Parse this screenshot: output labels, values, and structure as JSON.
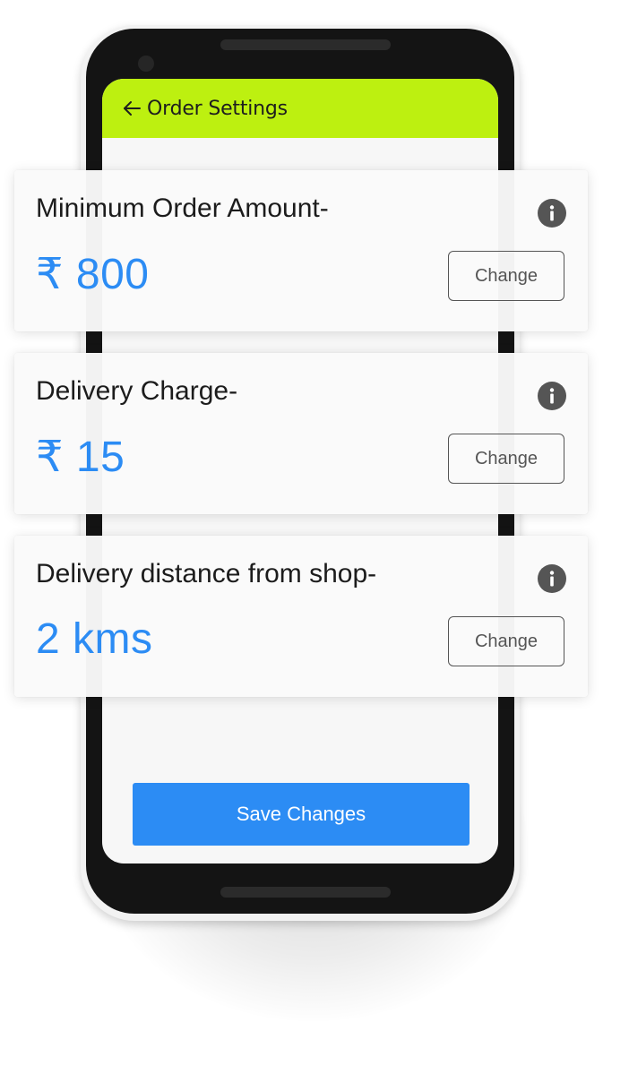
{
  "app_bar": {
    "back_icon": "arrow-left-icon",
    "title": "Order Settings",
    "background_color": "#bdf010"
  },
  "settings": [
    {
      "label": "Minimum Order Amount-",
      "value": "₹ 800",
      "info_icon": "info-icon",
      "button_label": "Change"
    },
    {
      "label": "Delivery Charge-",
      "value": "₹ 15",
      "info_icon": "info-icon",
      "button_label": "Change"
    },
    {
      "label": "Delivery distance from shop-",
      "value": "2 kms",
      "info_icon": "info-icon",
      "button_label": "Change"
    }
  ],
  "footer": {
    "save_label": "Save Changes"
  },
  "colors": {
    "accent": "#2c8cf4",
    "app_bar": "#bdf010",
    "text": "#1c1c1c",
    "button_border": "#555555"
  }
}
